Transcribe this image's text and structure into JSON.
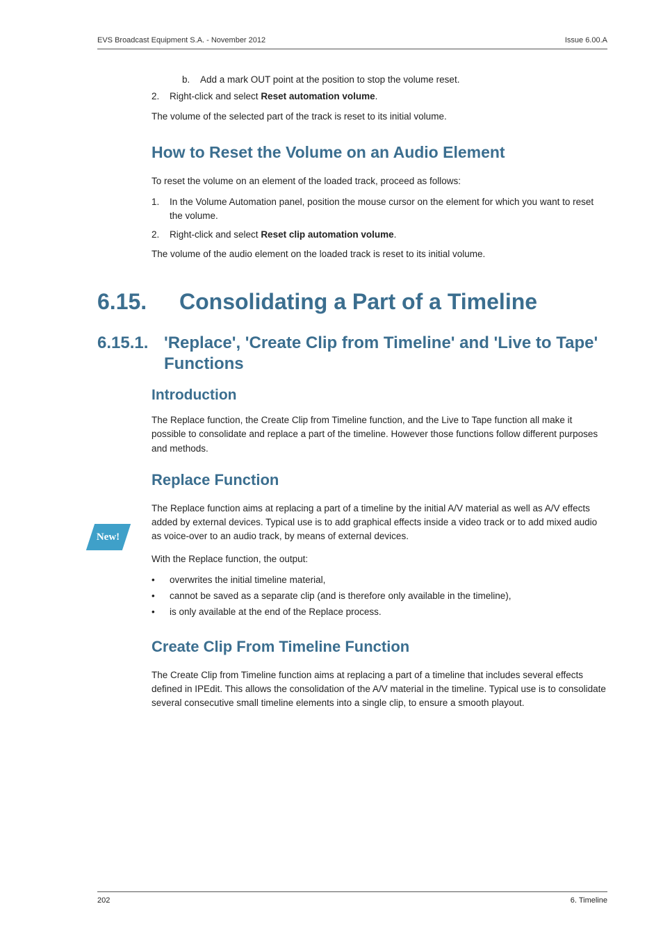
{
  "header": {
    "left": "EVS Broadcast Equipment S.A. - November 2012",
    "right": "Issue 6.00.A"
  },
  "step_b": {
    "letter": "b.",
    "text": "Add a mark OUT point at the position to stop the volume reset."
  },
  "step_2a": {
    "num": "2.",
    "prefix": "Right-click and select ",
    "bold": "Reset automation volume",
    "suffix": "."
  },
  "para_reset_part": "The volume of the selected part of the track is reset to its initial volume.",
  "h3_reset_elem": "How to Reset the Volume on an Audio Element",
  "para_reset_elem_intro": "To reset the volume on an element of the loaded track, proceed as follows:",
  "step_1b": {
    "num": "1.",
    "text": "In the Volume Automation panel, position the mouse cursor on the element for which you want to reset the volume."
  },
  "step_2b": {
    "num": "2.",
    "prefix": "Right-click and select ",
    "bold": "Reset clip automation volume",
    "suffix": "."
  },
  "para_reset_elem_result": "The volume of the audio element on the loaded track is reset to its initial volume.",
  "section": {
    "num": "6.15.",
    "title": "Consolidating a Part of a Timeline"
  },
  "subsection": {
    "num": "6.15.1.",
    "title": "'Replace', 'Create Clip from Timeline' and 'Live to Tape' Functions"
  },
  "h4_intro": "Introduction",
  "new_badge": "New!",
  "para_intro": "The Replace function, the Create Clip from Timeline function, and the Live to Tape function all make it possible to consolidate and replace a part of the timeline. However those functions follow different purposes and methods.",
  "h3_replace": "Replace Function",
  "para_replace": "The Replace function aims at replacing a part of a timeline by the initial A/V material as well as A/V effects added by external devices. Typical use is to add graphical effects inside a video track or to add mixed audio as voice-over to an audio track, by means of external devices.",
  "para_replace_output": "With the Replace function, the output:",
  "bullets": {
    "b1": "overwrites the initial timeline material,",
    "b2": "cannot be saved as a separate clip (and is therefore only available in the timeline),",
    "b3": "is only available at the end of the Replace process."
  },
  "h3_create": "Create Clip From Timeline Function",
  "para_create": "The Create Clip from Timeline function aims at replacing a part of a timeline that includes several effects defined in IPEdit. This allows the consolidation of the A/V material in the timeline. Typical use is to consolidate several consecutive small timeline elements into a single clip, to ensure a smooth playout.",
  "footer": {
    "left": "202",
    "right": "6. Timeline"
  }
}
